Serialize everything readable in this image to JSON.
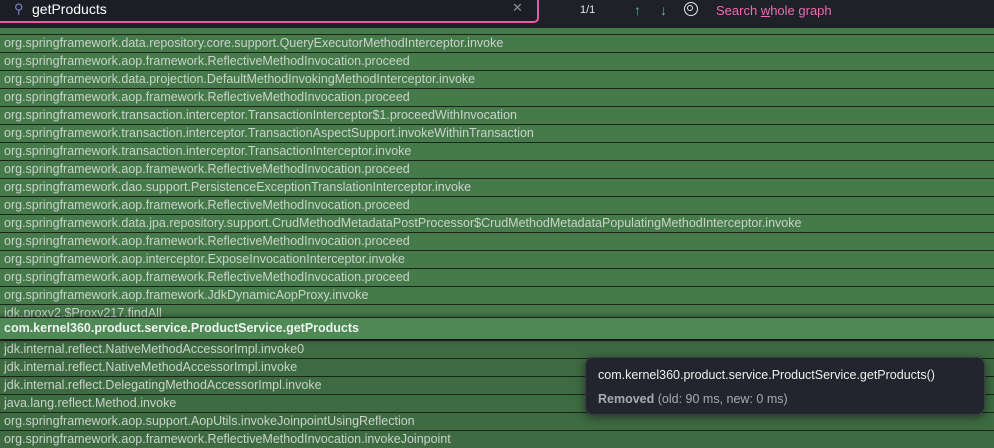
{
  "search": {
    "value": "getProducts",
    "match_count": "1/1",
    "whole_graph_prefix": "Search ",
    "whole_graph_key": "w",
    "whole_graph_suffix": "hole graph"
  },
  "colors": {
    "accent": "#e85aa6",
    "frame": "#467a4b",
    "frame_dark": "#3e6b42",
    "frame_highlight": "#4f8a56"
  },
  "frames": [
    "org.springframework.data.repository.core.support.QueryExecutorMethodInterceptor.invoke",
    "org.springframework.aop.framework.ReflectiveMethodInvocation.proceed",
    "org.springframework.data.projection.DefaultMethodInvokingMethodInterceptor.invoke",
    "org.springframework.aop.framework.ReflectiveMethodInvocation.proceed",
    "org.springframework.transaction.interceptor.TransactionInterceptor$1.proceedWithInvocation",
    "org.springframework.transaction.interceptor.TransactionAspectSupport.invokeWithinTransaction",
    "org.springframework.transaction.interceptor.TransactionInterceptor.invoke",
    "org.springframework.aop.framework.ReflectiveMethodInvocation.proceed",
    "org.springframework.dao.support.PersistenceExceptionTranslationInterceptor.invoke",
    "org.springframework.aop.framework.ReflectiveMethodInvocation.proceed",
    "org.springframework.data.jpa.repository.support.CrudMethodMetadataPostProcessor$CrudMethodMetadataPopulatingMethodInterceptor.invoke",
    "org.springframework.aop.framework.ReflectiveMethodInvocation.proceed",
    "org.springframework.aop.interceptor.ExposeInvocationInterceptor.invoke",
    "org.springframework.aop.framework.ReflectiveMethodInvocation.proceed",
    "org.springframework.aop.framework.JdkDynamicAopProxy.invoke",
    "jdk.proxy2.$Proxy217.findAll"
  ],
  "highlighted_frame": "com.kernel360.product.service.ProductService.getProducts",
  "frames_below": [
    "jdk.internal.reflect.NativeMethodAccessorImpl.invoke0",
    "jdk.internal.reflect.NativeMethodAccessorImpl.invoke",
    "jdk.internal.reflect.DelegatingMethodAccessorImpl.invoke",
    "java.lang.reflect.Method.invoke",
    "org.springframework.aop.support.AopUtils.invokeJoinpointUsingReflection",
    "org.springframework.aop.framework.ReflectiveMethodInvocation.invokeJoinpoint"
  ],
  "tooltip": {
    "title": "com.kernel360.product.service.ProductService.getProducts()",
    "status": "Removed",
    "detail": " (old: 90 ms, new: 0 ms)"
  }
}
